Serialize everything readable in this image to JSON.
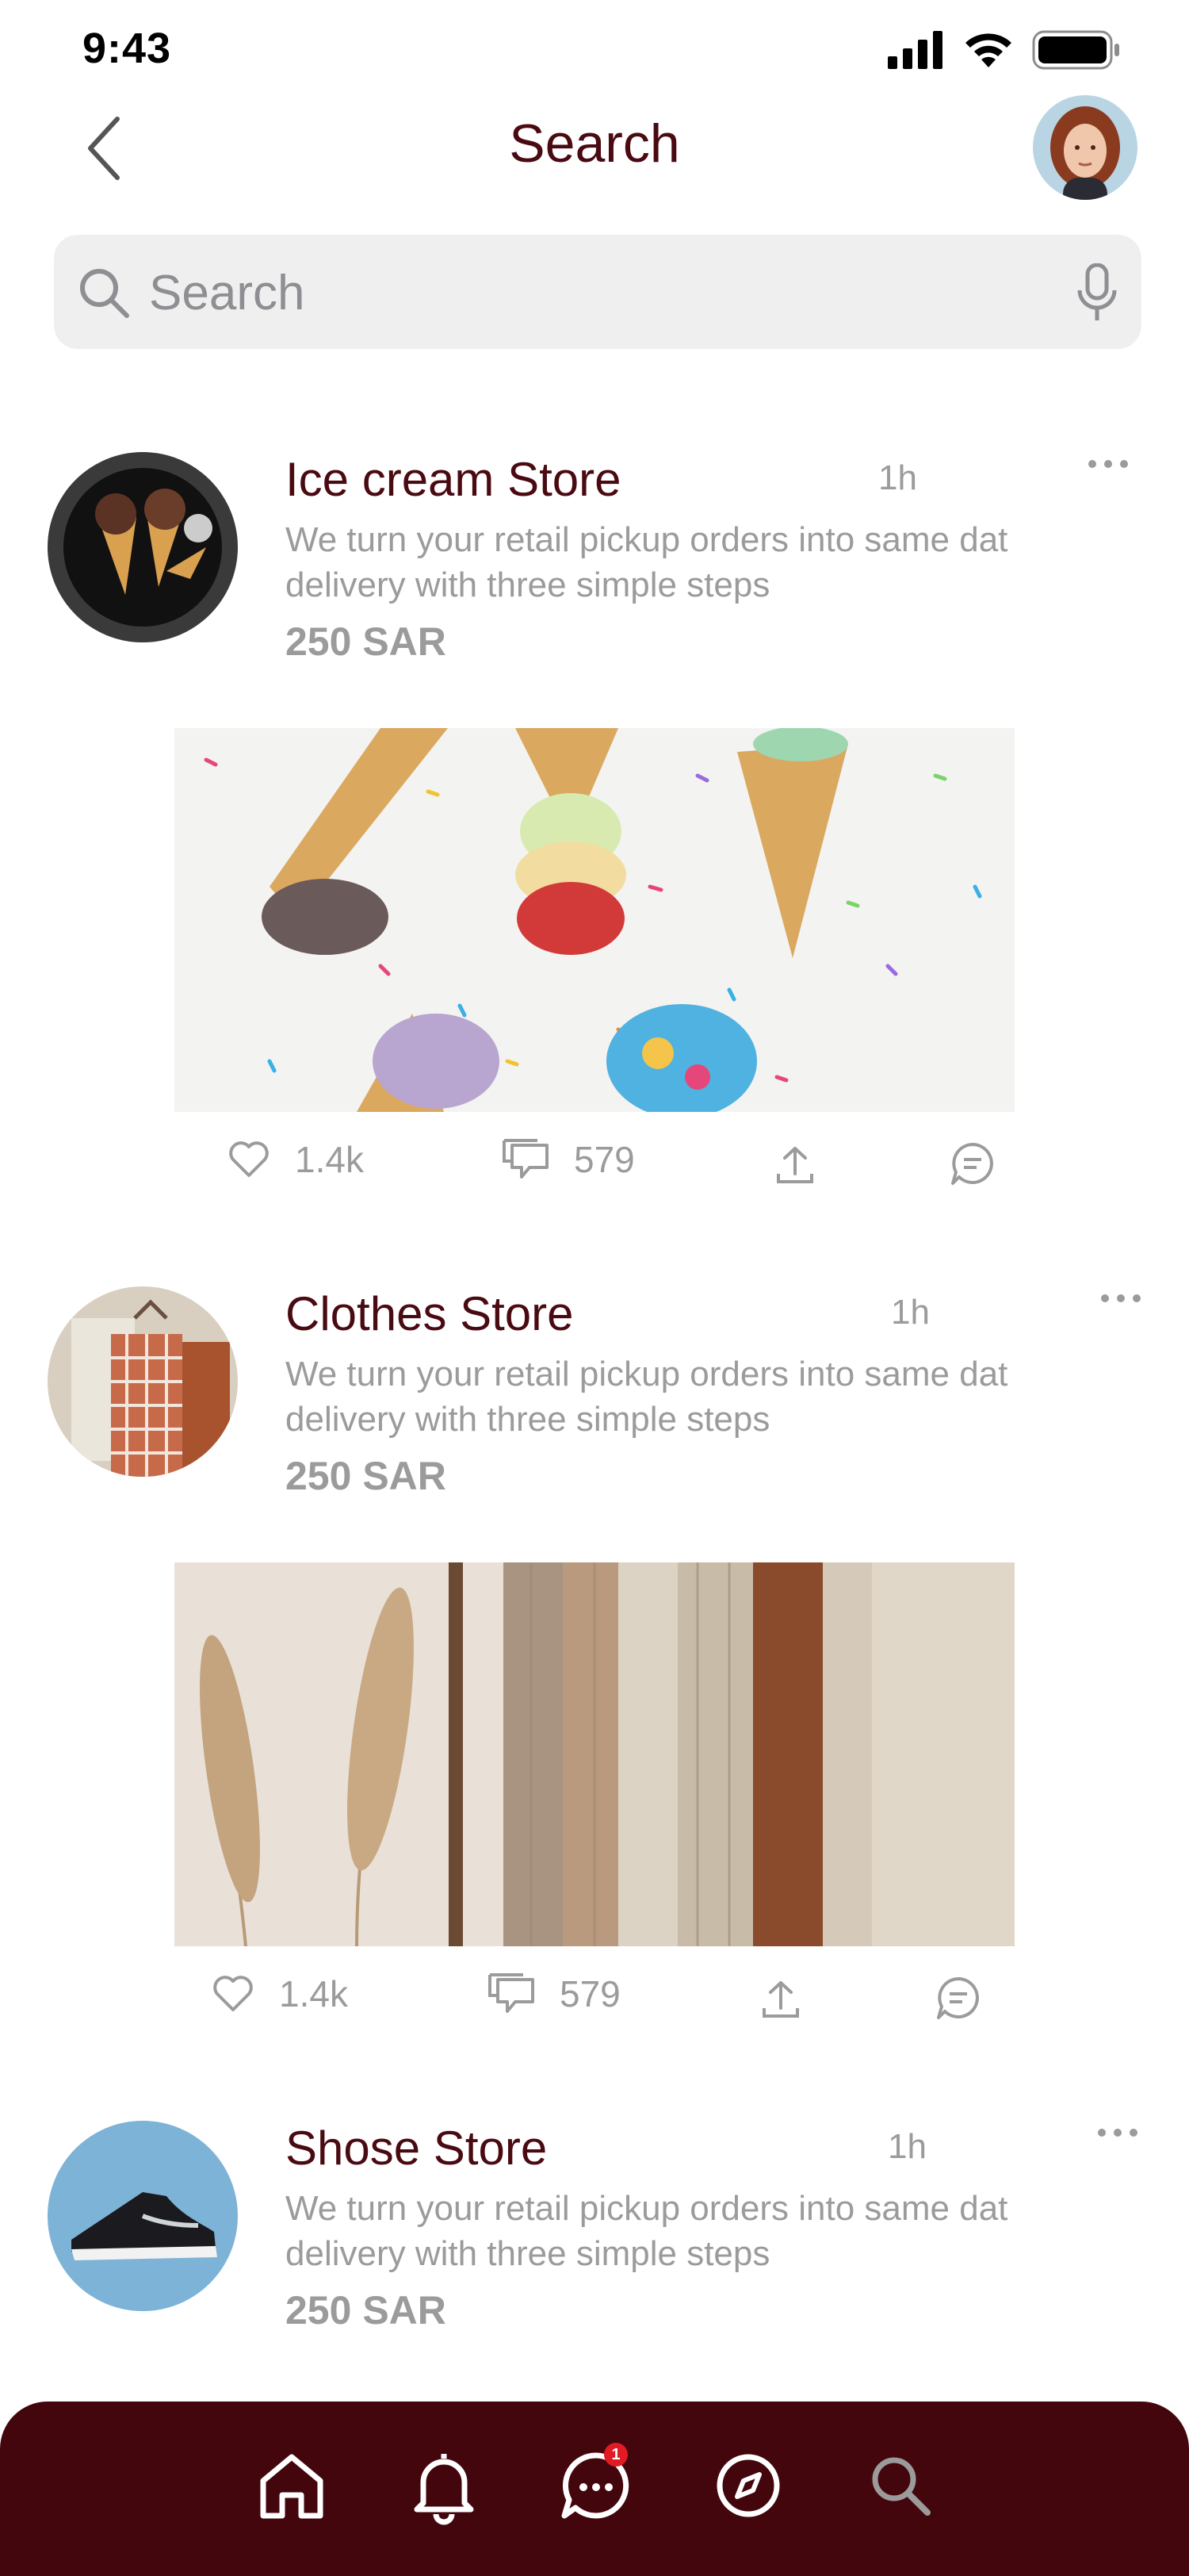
{
  "status_bar": {
    "time": "9:43"
  },
  "header": {
    "title": "Search"
  },
  "search": {
    "placeholder": "Search"
  },
  "posts": [
    {
      "name": "Ice cream Store",
      "time": "1h",
      "description_line1": "We turn your retail pickup orders into same dat",
      "description_line2": "delivery with three simple steps",
      "price": "250 SAR",
      "likes": "1.4k",
      "comments": "579"
    },
    {
      "name": "Clothes Store",
      "time": "1h",
      "description_line1": "We turn your retail pickup orders into same dat",
      "description_line2": "delivery with three simple steps",
      "price": "250 SAR",
      "likes": "1.4k",
      "comments": "579"
    },
    {
      "name": "Shose Store",
      "time": "1h",
      "description_line1": "We turn your retail pickup orders into same dat",
      "description_line2": "delivery with three simple steps",
      "price": "250 SAR"
    }
  ],
  "tabbar": {
    "items": [
      "home-icon",
      "bell-icon",
      "chat-icon",
      "compass-icon",
      "search-icon"
    ],
    "chat_badge": "1"
  },
  "colors": {
    "brand": "#43060c",
    "title": "#4a0a12",
    "muted": "#9b9b9b",
    "badge": "#e01b24"
  }
}
